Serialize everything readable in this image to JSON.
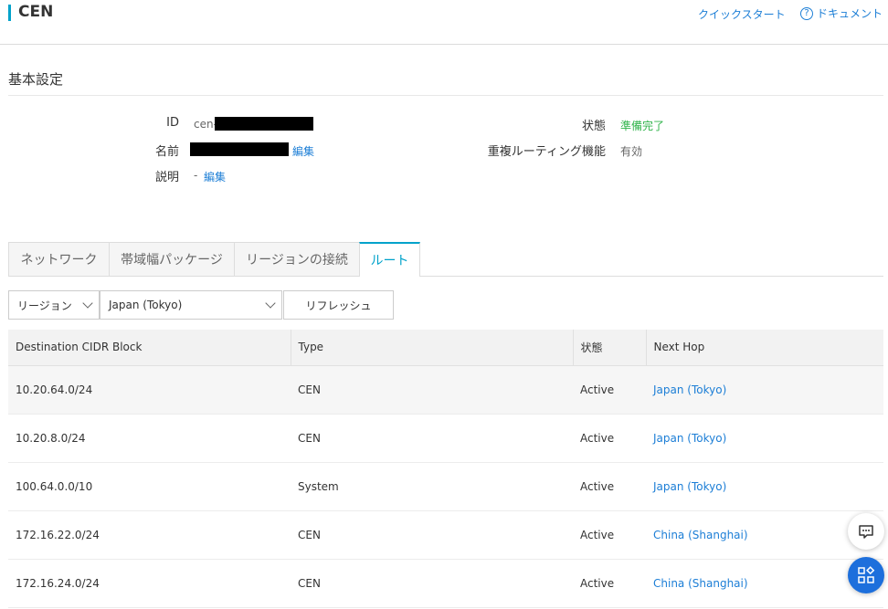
{
  "header": {
    "title": "CEN",
    "quickstart": "クイックスタート",
    "docs": "ドキュメント",
    "help_glyph": "?"
  },
  "basic": {
    "section_title": "基本設定",
    "id_label": "ID",
    "id_prefix": "cen-",
    "name_label": "名前",
    "name_edit": "編集",
    "desc_label": "説明",
    "desc_value": "-",
    "desc_edit": "編集",
    "status_label": "状態",
    "status_value": "準備完了",
    "status_color": "#2fb34a",
    "overlap_label": "重複ルーティング機能",
    "overlap_value": "有効"
  },
  "tabs": [
    {
      "label": "ネットワーク",
      "active": false
    },
    {
      "label": "帯域幅パッケージ",
      "active": false
    },
    {
      "label": "リージョンの接続",
      "active": false
    },
    {
      "label": "ルート",
      "active": true
    }
  ],
  "filters": {
    "region_type": "リージョン",
    "region_value": "Japan (Tokyo)",
    "refresh": "リフレッシュ"
  },
  "table": {
    "headers": [
      "Destination CIDR Block",
      "Type",
      "状態",
      "Next Hop"
    ],
    "rows": [
      {
        "cidr": "10.20.64.0/24",
        "type": "CEN",
        "status": "Active",
        "hop": "Japan (Tokyo)"
      },
      {
        "cidr": "10.20.8.0/24",
        "type": "CEN",
        "status": "Active",
        "hop": "Japan (Tokyo)"
      },
      {
        "cidr": "100.64.0.0/10",
        "type": "System",
        "status": "Active",
        "hop": "Japan (Tokyo)"
      },
      {
        "cidr": "172.16.22.0/24",
        "type": "CEN",
        "status": "Active",
        "hop": "China (Shanghai)"
      },
      {
        "cidr": "172.16.24.0/24",
        "type": "CEN",
        "status": "Active",
        "hop": "China (Shanghai)"
      }
    ]
  },
  "colors": {
    "accent": "#00a2ca",
    "link": "#1c7ed6",
    "float_app": "#1d6fdc"
  },
  "icons": [
    "help-icon",
    "chevron-down-icon",
    "chat-icon",
    "app-grid-icon"
  ]
}
